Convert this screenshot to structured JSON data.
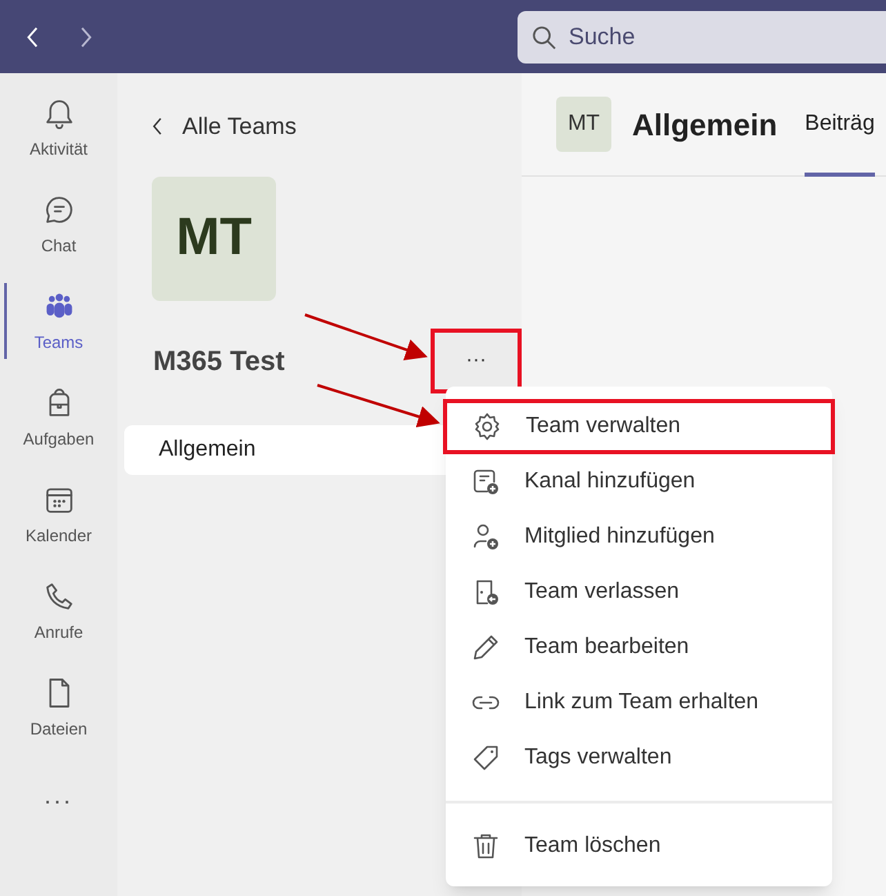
{
  "title_bar": {
    "search": {
      "placeholder": "Suche"
    }
  },
  "app_bar": [
    {
      "label": "Aktivität",
      "selected": false
    },
    {
      "label": "Chat",
      "selected": false
    },
    {
      "label": "Teams",
      "selected": true
    },
    {
      "label": "Aufgaben",
      "selected": false
    },
    {
      "label": "Kalender",
      "selected": false
    },
    {
      "label": "Anrufe",
      "selected": false
    },
    {
      "label": "Dateien",
      "selected": false
    }
  ],
  "more_apps": "...",
  "team_panel": {
    "back_label": "Alle Teams",
    "avatar": "MT",
    "team_name": "M365 Test",
    "more_button": {
      "label": "···",
      "highlighted": true
    },
    "channels": [
      {
        "name": "Allgemein",
        "selected": true
      }
    ]
  },
  "channel_header": {
    "avatar": "MT",
    "title": "Allgemein",
    "tabs": [
      {
        "label": "Beiträg",
        "selected": true
      }
    ]
  },
  "context_menu": [
    {
      "kind": "item",
      "label": "Team verwalten",
      "highlighted": true
    },
    {
      "kind": "item",
      "label": "Kanal hinzufügen",
      "highlighted": false
    },
    {
      "kind": "item",
      "label": "Mitglied hinzufügen",
      "highlighted": false
    },
    {
      "kind": "item",
      "label": "Team verlassen",
      "highlighted": false
    },
    {
      "kind": "item",
      "label": "Team bearbeiten",
      "highlighted": false
    },
    {
      "kind": "item",
      "label": "Link zum Team erhalten",
      "highlighted": false
    },
    {
      "kind": "item",
      "label": "Tags verwalten",
      "highlighted": false
    },
    {
      "kind": "divider"
    },
    {
      "kind": "item",
      "label": "Team löschen",
      "highlighted": false
    }
  ]
}
